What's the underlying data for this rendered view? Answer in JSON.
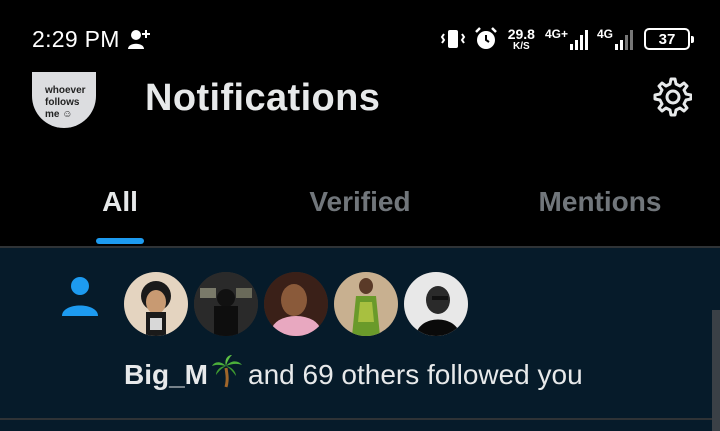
{
  "status_bar": {
    "time": "2:29 PM",
    "net_speed_value": "29.8",
    "net_speed_unit": "K/S",
    "signal1_label": "4G+",
    "signal2_label": "4G",
    "battery_level": "37",
    "icons": [
      "add-user-icon",
      "vibrate-icon",
      "alarm-icon",
      "signal-icon",
      "battery-icon"
    ]
  },
  "header": {
    "title": "Notifications",
    "avatar_lines": [
      "whoever",
      "follows",
      "me ☺"
    ],
    "settings_icon": "gear-icon"
  },
  "tabs": [
    {
      "label": "All",
      "active": true
    },
    {
      "label": "Verified",
      "active": false
    },
    {
      "label": "Mentions",
      "active": false
    }
  ],
  "notification": {
    "type_icon": "person-icon",
    "name": "Big_M",
    "emoji": "palm-tree",
    "rest": "and 69 others followed you",
    "avatar_count": 5
  },
  "colors": {
    "accent": "#1d9bf0",
    "background": "#000000",
    "notification_bg": "#061b2a",
    "muted_text": "#71767b"
  }
}
